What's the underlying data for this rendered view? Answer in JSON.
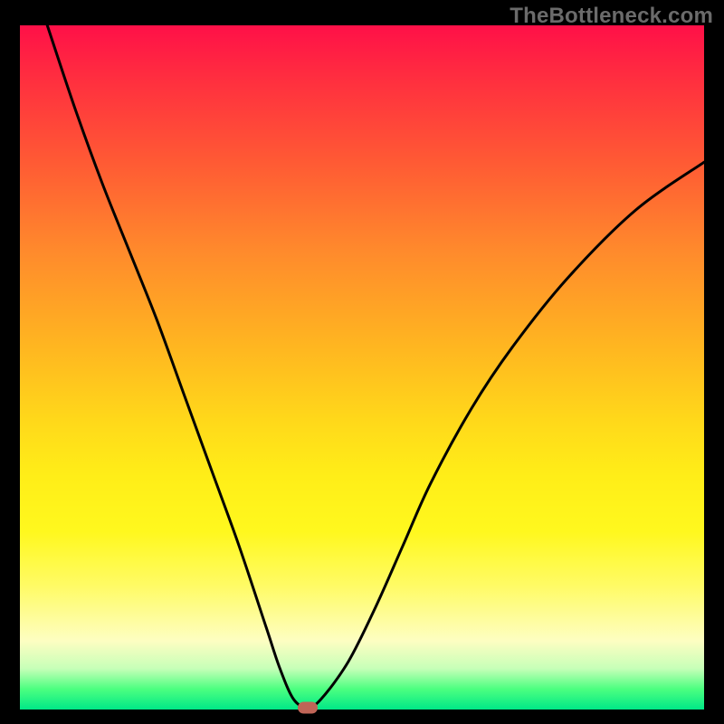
{
  "watermark": "TheBottleneck.com",
  "chart_data": {
    "type": "line",
    "title": "",
    "xlabel": "",
    "ylabel": "",
    "xlim": [
      0,
      100
    ],
    "ylim": [
      0,
      100
    ],
    "min_marker": {
      "x": 42,
      "y": 0.3
    },
    "series": [
      {
        "name": "curve",
        "x": [
          4,
          8,
          12,
          16,
          20,
          24,
          28,
          32,
          36,
          38,
          40,
          42,
          44,
          48,
          52,
          56,
          60,
          66,
          72,
          80,
          90,
          100
        ],
        "y": [
          100,
          88,
          77,
          67,
          57,
          46,
          35,
          24,
          12,
          6,
          1.5,
          0.3,
          1.5,
          7,
          15,
          24,
          33,
          44,
          53,
          63,
          73,
          80
        ]
      }
    ],
    "gradient_stops": [
      {
        "pos": 0,
        "label": "red"
      },
      {
        "pos": 50,
        "label": "orange"
      },
      {
        "pos": 70,
        "label": "yellow"
      },
      {
        "pos": 100,
        "label": "green"
      }
    ]
  }
}
